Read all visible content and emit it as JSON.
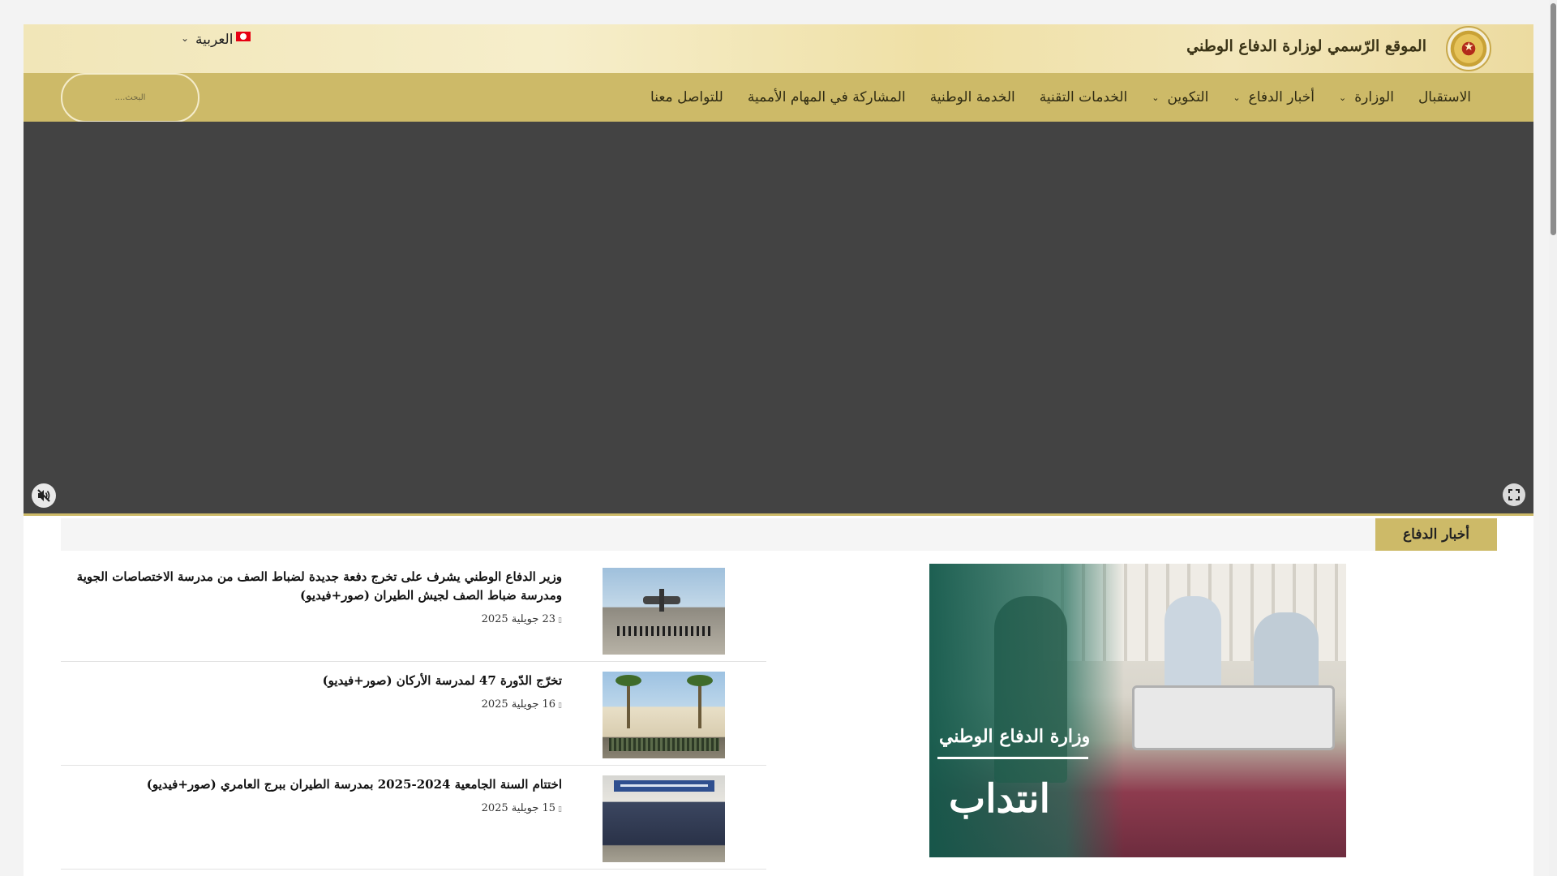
{
  "header": {
    "site_title": "الموقع الرّسمي لوزارة الدفاع الوطني",
    "language": "العربية"
  },
  "nav": {
    "items": [
      {
        "label": "الاستقبال",
        "dropdown": false
      },
      {
        "label": "الوزارة",
        "dropdown": true
      },
      {
        "label": "أخبار الدفاع",
        "dropdown": true
      },
      {
        "label": "التكوين",
        "dropdown": true
      },
      {
        "label": "الخدمات التقنية",
        "dropdown": true
      },
      {
        "label": "الخدمة الوطنية",
        "dropdown": false
      },
      {
        "label": "المشاركة في المهام الأممية",
        "dropdown": false
      },
      {
        "label": "للتواصل معنا",
        "dropdown": false
      }
    ],
    "search_placeholder": "البحث...."
  },
  "video": {
    "mute_icon": "muted-speaker-icon",
    "fullscreen_icon": "fullscreen-icon"
  },
  "section": {
    "title": "أخبار الدفاع"
  },
  "news": [
    {
      "title": "وزير الدفاع الوطني يشرف على تخرج دفعة جديدة لضباط الصف من مدرسة الاختصاصات الجوية ومدرسة ضباط الصف لجيش الطيران (صور+فيديو)",
      "date": "23 جويلية 2025"
    },
    {
      "title": "تخرّج الدّورة 47 لمدرسة الأركان (صور+فيديو)",
      "date": "16 جويلية 2025"
    },
    {
      "title": "اختتام السنة الجامعية 2024-2025 بمدرسة الطيران ببرج العامري (صور+فيديو)",
      "date": "15 جويلية 2025"
    }
  ],
  "banner": {
    "subtitle": "وزارة الدفاع الوطني",
    "title": "انتداب"
  },
  "colors": {
    "nav_gold": "#cdba68",
    "video_bg": "#434343"
  }
}
